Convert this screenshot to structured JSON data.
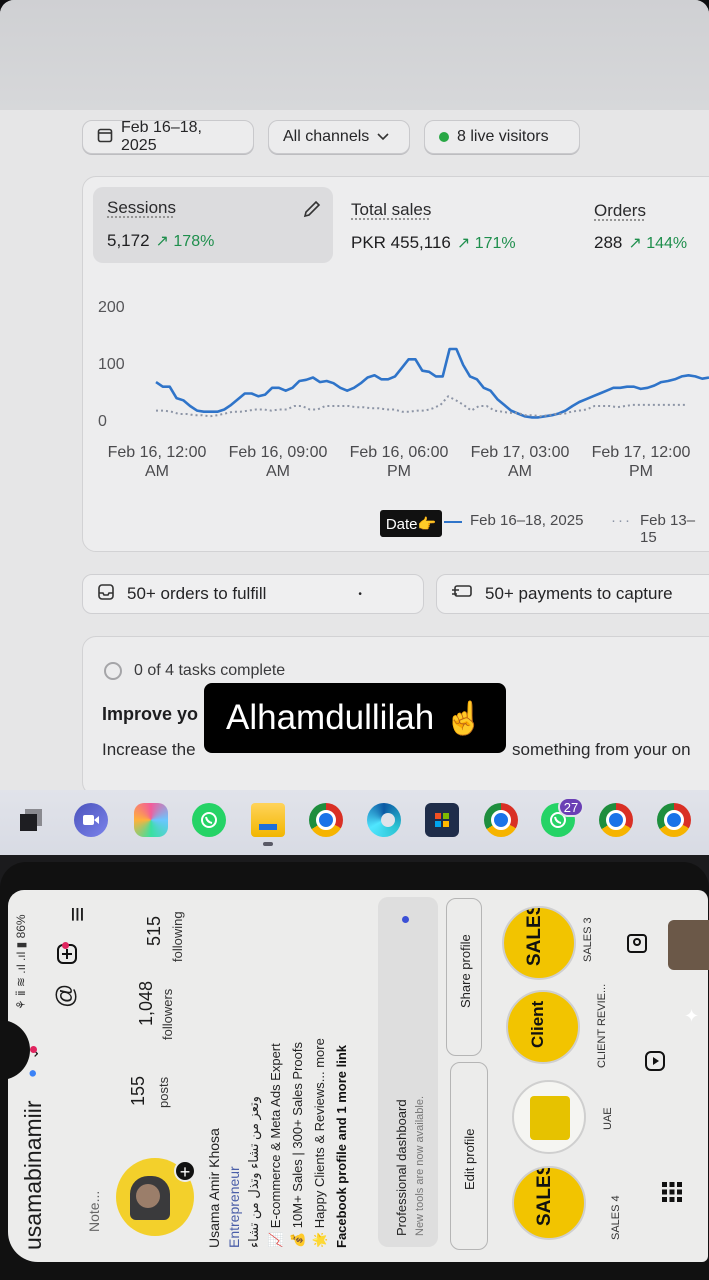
{
  "dashboard": {
    "date_range": "Feb 16–18, 2025",
    "channels": "All channels",
    "live_visitors": "8 live visitors",
    "metrics": {
      "sessions": {
        "title": "Sessions",
        "value": "5,172",
        "delta": "↗ 178%"
      },
      "total_sales": {
        "title": "Total sales",
        "value": "PKR 455,116",
        "delta": "↗ 171%"
      },
      "orders": {
        "title": "Orders",
        "value": "288",
        "delta": "↗ 144%"
      }
    },
    "legend": {
      "current": "Feb 16–18, 2025",
      "previous": "Feb 13–15",
      "date_badge": "Date👉"
    },
    "orders_to_fulfill": "50+ orders to fulfill",
    "payments_to_capture": "50+ payments to capture",
    "tasks": {
      "progress": "0 of 4 tasks complete",
      "heading": "Improve yo",
      "description": "Increase the",
      "description_tail": "something from your on"
    }
  },
  "chart_data": {
    "type": "line",
    "x": [
      "Feb 16, 12:00 AM",
      "Feb 16, 09:00 AM",
      "Feb 16, 06:00 PM",
      "Feb 17, 03:00 AM",
      "Feb 17, 12:00 PM"
    ],
    "y_ticks": [
      "0",
      "100",
      "200"
    ],
    "ylim": [
      0,
      200
    ],
    "series": [
      {
        "name": "Feb 16–18, 2025",
        "color": "#2f74c9",
        "style": "solid",
        "values": [
          70,
          62,
          62,
          42,
          38,
          28,
          20,
          18,
          18,
          18,
          22,
          30,
          40,
          50,
          50,
          45,
          48,
          60,
          60,
          55,
          60,
          72,
          74,
          78,
          70,
          72,
          68,
          60,
          55,
          60,
          68,
          78,
          82,
          75,
          75,
          80,
          95,
          110,
          110,
          90,
          88,
          80,
          80,
          128,
          128,
          100,
          80,
          75,
          60,
          55,
          40,
          30,
          20,
          15,
          10,
          8,
          8,
          10,
          12,
          15,
          20,
          28,
          35,
          40,
          45,
          50,
          55,
          60,
          60,
          62,
          62,
          58,
          60,
          64,
          70,
          72,
          75,
          80,
          82,
          80,
          76,
          78
        ]
      },
      {
        "name": "Feb 13–15",
        "color": "#8d95a6",
        "style": "dotted",
        "values": [
          20,
          20,
          18,
          14,
          14,
          12,
          12,
          10,
          12,
          15,
          18,
          18,
          20,
          22,
          22,
          20,
          22,
          22,
          28,
          28,
          22,
          22,
          28,
          28,
          28,
          28,
          26,
          26,
          24,
          24,
          22,
          22,
          18,
          18,
          20,
          20,
          24,
          30,
          45,
          38,
          30,
          20,
          28,
          28,
          20,
          18,
          16,
          16,
          12,
          12,
          10,
          12,
          14,
          14,
          18,
          20,
          22,
          28,
          28,
          28,
          26,
          28,
          30,
          30,
          30,
          30,
          30,
          30,
          30,
          30
        ]
      }
    ]
  },
  "taskbar": {
    "icons": [
      "task-view-icon",
      "meet-icon",
      "copilot-icon",
      "whatsapp-icon",
      "file-explorer-icon",
      "chrome-icon",
      "edge-icon",
      "store-icon",
      "chrome-icon",
      "whatsapp-icon",
      "chrome-icon",
      "chrome-icon"
    ],
    "whatsapp_badge": "27"
  },
  "overlay_caption": "Alhamdullilah",
  "overlay_emoji": "☝️",
  "instagram": {
    "status_bar": "86%",
    "username": "usamabinamiir",
    "posts_count": "155",
    "posts_label": "posts",
    "followers_count": "1,048",
    "followers_label": "followers",
    "following_count": "515",
    "following_label": "following",
    "note": "Note...",
    "name": "Usama Amir Khosa",
    "category": "Entrepreneur",
    "bio_urdu": "وتعز من تشاء وتذل من تشاء",
    "bio_line1": "📈 E-commerce & Meta Ads Expert",
    "bio_line2": "💰 10M+ Sales | 300+ Sales Proofs",
    "bio_line3": "🌟 Happy Clients & Reviews... more",
    "bio_line4": "Facebook profile and 1 more link",
    "pro_dashboard": "Professional dashboard",
    "pro_dashboard_sub": "New tools are now available.",
    "edit_profile": "Edit profile",
    "share_profile": "Share profile",
    "highlights": [
      {
        "cover": "SALES",
        "label": "SALES 4"
      },
      {
        "cover": "",
        "label": "UAE"
      },
      {
        "cover": "Client",
        "label": "CLIENT REVIE..."
      },
      {
        "cover": "SALES",
        "label": "SALES 3"
      }
    ]
  }
}
